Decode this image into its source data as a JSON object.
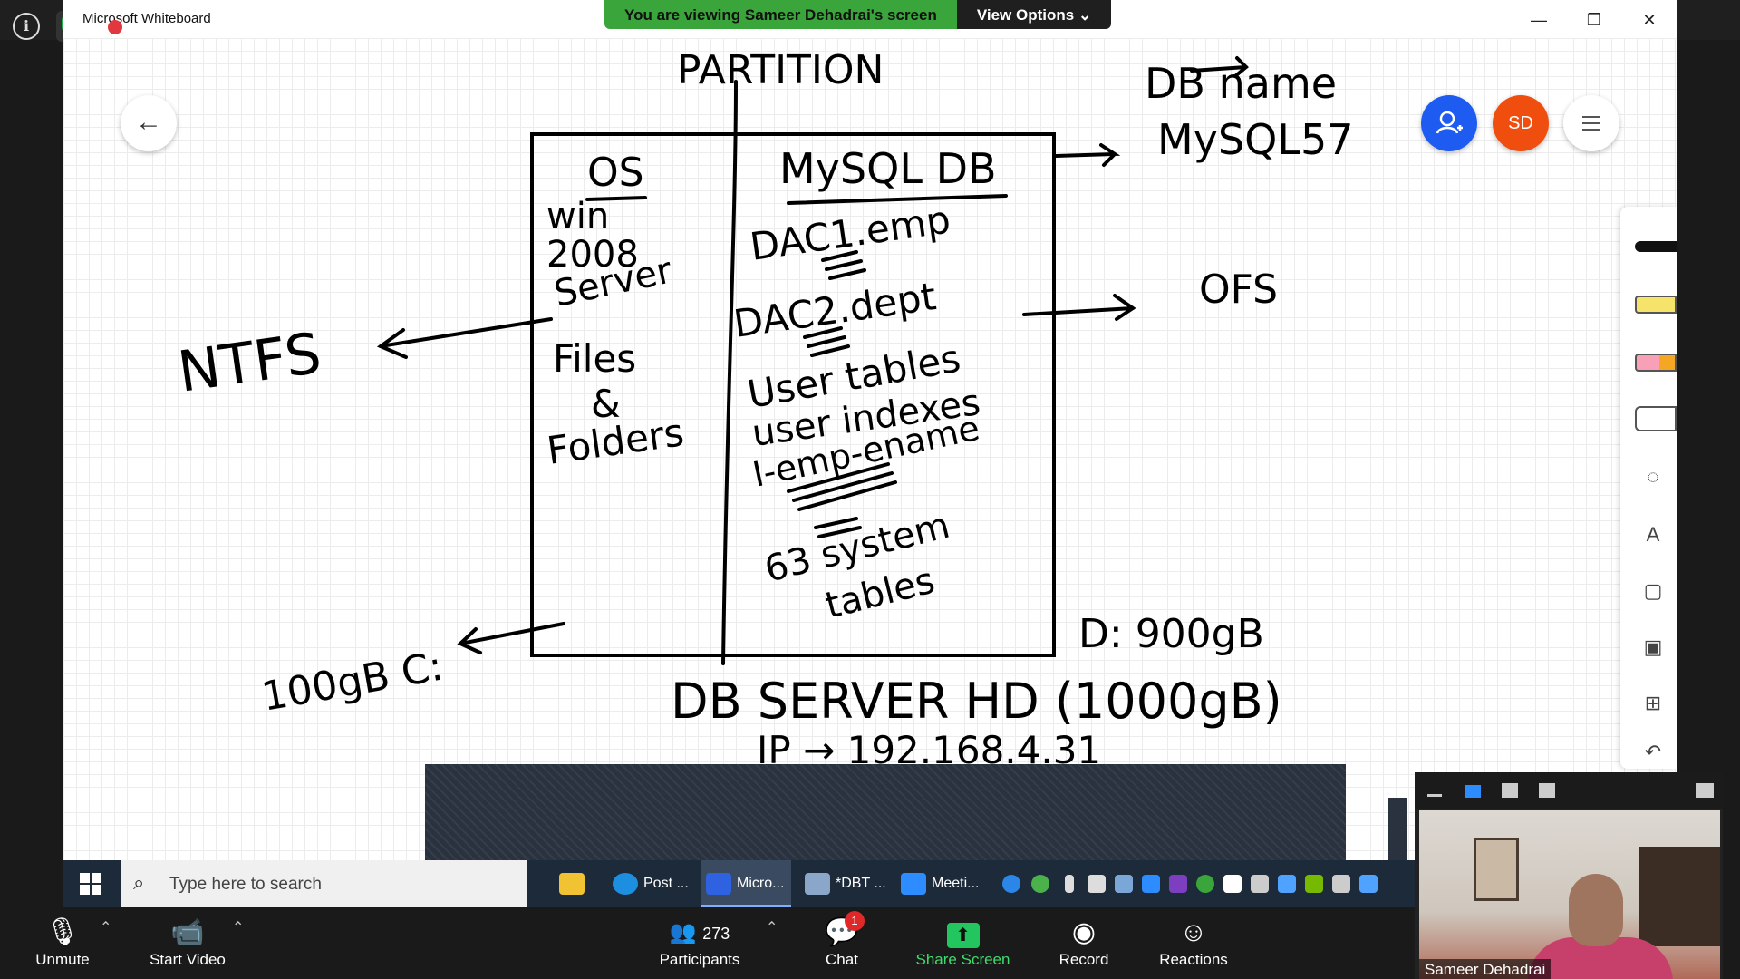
{
  "top": {
    "info_glyph": "i",
    "shield_glyph": "✓"
  },
  "whiteboard": {
    "app_name": "Microsoft Whiteboard",
    "window_controls": {
      "minimize": "—",
      "restore": "❐",
      "close": "✕"
    },
    "avatar_initials": "SD",
    "ink": {
      "partition": "PARTITION",
      "db_name": "DB name",
      "mysql57": "MySQL57",
      "os": "OS",
      "mysql_db": "MySQL DB",
      "win": "win",
      "year": "2008",
      "server": "Server",
      "dac1": "DAC1.emp",
      "dac2": "DAC2.dept",
      "ofs": "OFS",
      "ntfs": "NTFS",
      "files": "Files",
      "amp": "&",
      "folders": "Folders",
      "user_tables": "User tables",
      "user_indexes": "user indexes",
      "index_name": "I-emp-ename",
      "sys_tables_1": "63 system",
      "sys_tables_2": "tables",
      "c_drive": "100gB C:",
      "d_drive": "D: 900gB",
      "db_server": "DB SERVER HD (1000gB)",
      "ip": "IP → 192.168.4.31"
    }
  },
  "share_banner": {
    "message": "You are viewing Sameer Dehadrai's screen",
    "options": "View Options ⌄"
  },
  "taskbar": {
    "search_placeholder": "Type here to search",
    "apps": [
      {
        "label": "Post ...",
        "color": "#1c8fe0"
      },
      {
        "label": "Micro...",
        "color": "#2f62e0"
      },
      {
        "label": "*DBT ...",
        "color": "#8aa6c8"
      },
      {
        "label": "Meeti...",
        "color": "#2d8cff"
      }
    ],
    "tray_colors": [
      "#2b86e8",
      "#4bb14a",
      "#dddddd",
      "#dddddd",
      "#7aa6d8",
      "#2d8cff",
      "#7b3fbf",
      "#3aa53a",
      "#ffffff",
      "#cccccc",
      "#4fa3ff",
      "#76b900",
      "#cccccc",
      "#4fa3ff"
    ]
  },
  "zoom": {
    "unmute": "Unmute",
    "start_video": "Start Video",
    "participants": "Participants",
    "participant_count": "273",
    "chat": "Chat",
    "chat_badge": "1",
    "share_screen": "Share Screen",
    "record": "Record",
    "reactions": "Reactions",
    "video_name": "Sameer Dehadrai"
  }
}
